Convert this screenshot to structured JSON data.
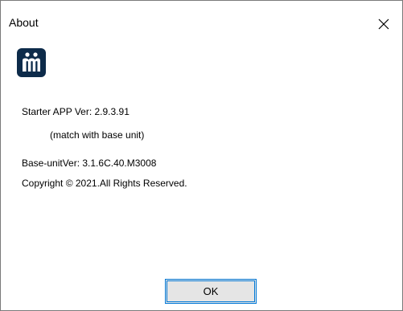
{
  "window": {
    "title": "About",
    "close_icon": "close-icon",
    "close_glyph": "✕"
  },
  "logo": {
    "icon": "app-logo-icon",
    "colors": {
      "background": "#0d2b4a",
      "accent": "#ffffff"
    }
  },
  "info": {
    "starter_version": "Starter APP Ver: 2.9.3.91",
    "match_note": "(match with base unit)",
    "base_unit_version": "Base-unitVer: 3.1.6C.40.M3008",
    "copyright": "Copyright © 2021.All Rights Reserved."
  },
  "buttons": {
    "ok_label": "OK"
  },
  "colors": {
    "accent": "#0078d7",
    "button_face": "#e5e5e5",
    "window_border": "#7a7a7a"
  }
}
